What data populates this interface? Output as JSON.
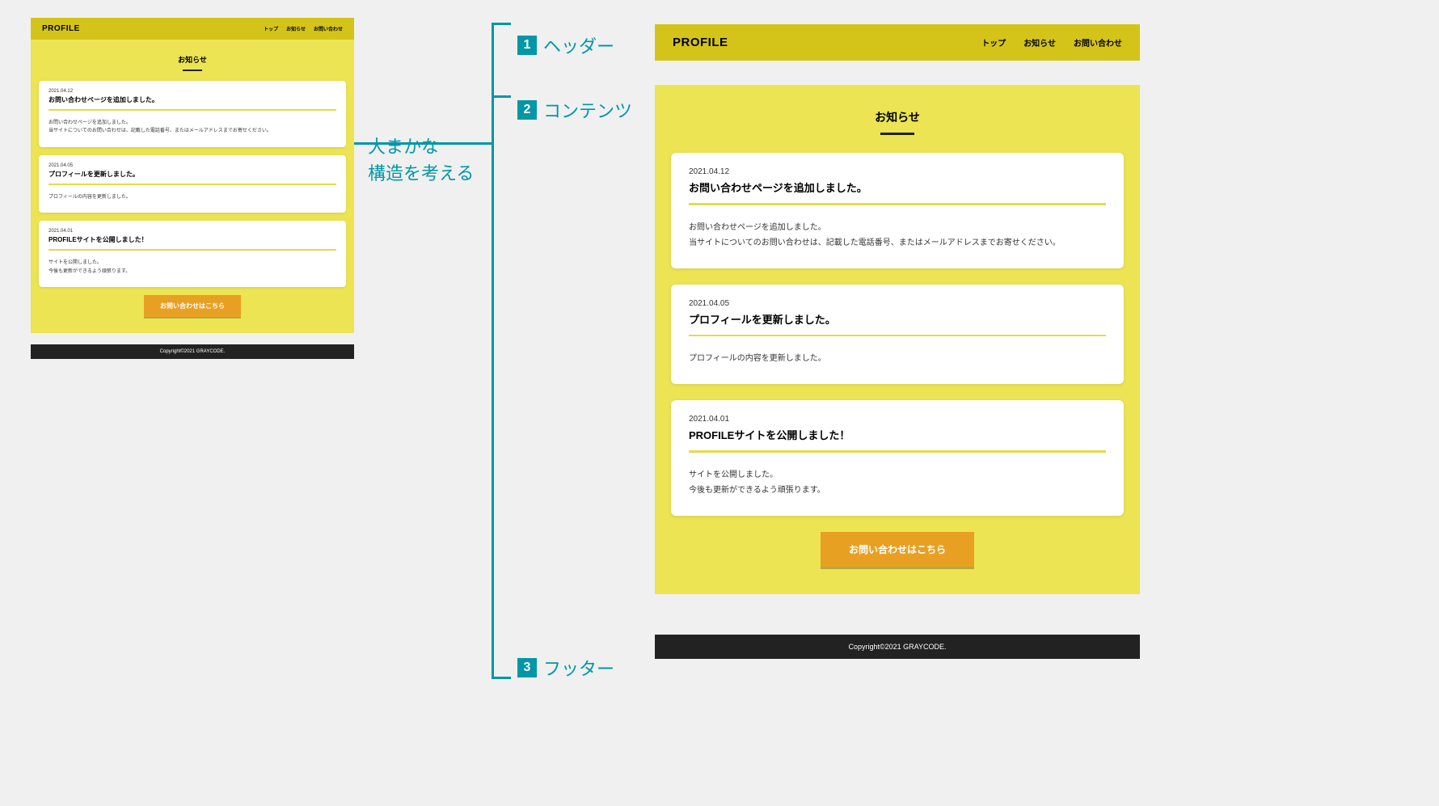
{
  "annotations": {
    "main_line1": "大まかな",
    "main_line2": "構造を考える",
    "label1": "ヘッダー",
    "label2": "コンテンツ",
    "label3": "フッター",
    "num1": "1",
    "num2": "2",
    "num3": "3"
  },
  "site": {
    "logo": "PROFILE",
    "nav": {
      "top": "トップ",
      "news": "お知らせ",
      "contact": "お問い合わせ"
    },
    "section_title": "お知らせ",
    "cta": "お問い合わせはこちら",
    "copyright": "Copyright©2021 GRAYCODE."
  },
  "posts": [
    {
      "date": "2021.04.12",
      "title": "お問い合わせページを追加しました。",
      "body1": "お問い合わせページを追加しました。",
      "body2": "当サイトについてのお問い合わせは、記載した電話番号、またはメールアドレスまでお寄せください。"
    },
    {
      "date": "2021.04.05",
      "title": "プロフィールを更新しました。",
      "body1": "プロフィールの内容を更新しました。",
      "body2": ""
    },
    {
      "date": "2021.04.01",
      "title": "PROFILEサイトを公開しました！",
      "body1": "サイトを公開しました。",
      "body2": "今後も更新ができるよう頑張ります。"
    }
  ]
}
